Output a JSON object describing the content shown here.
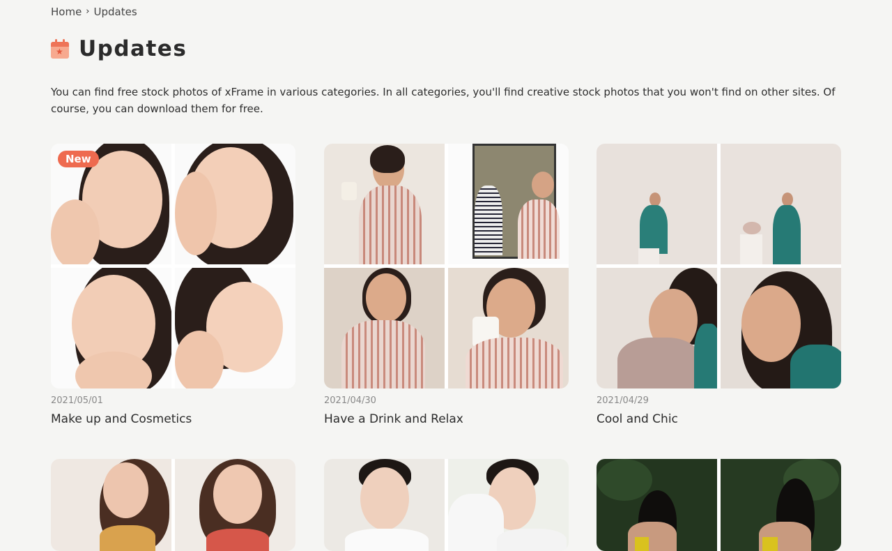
{
  "breadcrumb": {
    "home": "Home",
    "separator": "›",
    "current": "Updates"
  },
  "page": {
    "title": "Updates",
    "icon": "calendar-star-icon",
    "intro": "You can find free stock photos of xFrame in various categories. In all categories, you'll find creative stock photos that you won't find on other sites. Of course, you can download them for free."
  },
  "cards": [
    {
      "date": "2021/05/01",
      "title": "Make up and Cosmetics",
      "badge": "New"
    },
    {
      "date": "2021/04/30",
      "title": "Have a Drink and Relax"
    },
    {
      "date": "2021/04/29",
      "title": "Cool and Chic"
    },
    {
      "date": "",
      "title": ""
    },
    {
      "date": "",
      "title": ""
    },
    {
      "date": "",
      "title": ""
    }
  ],
  "colors": {
    "accent": "#ee6a4f",
    "background": "#f5f5f3"
  }
}
